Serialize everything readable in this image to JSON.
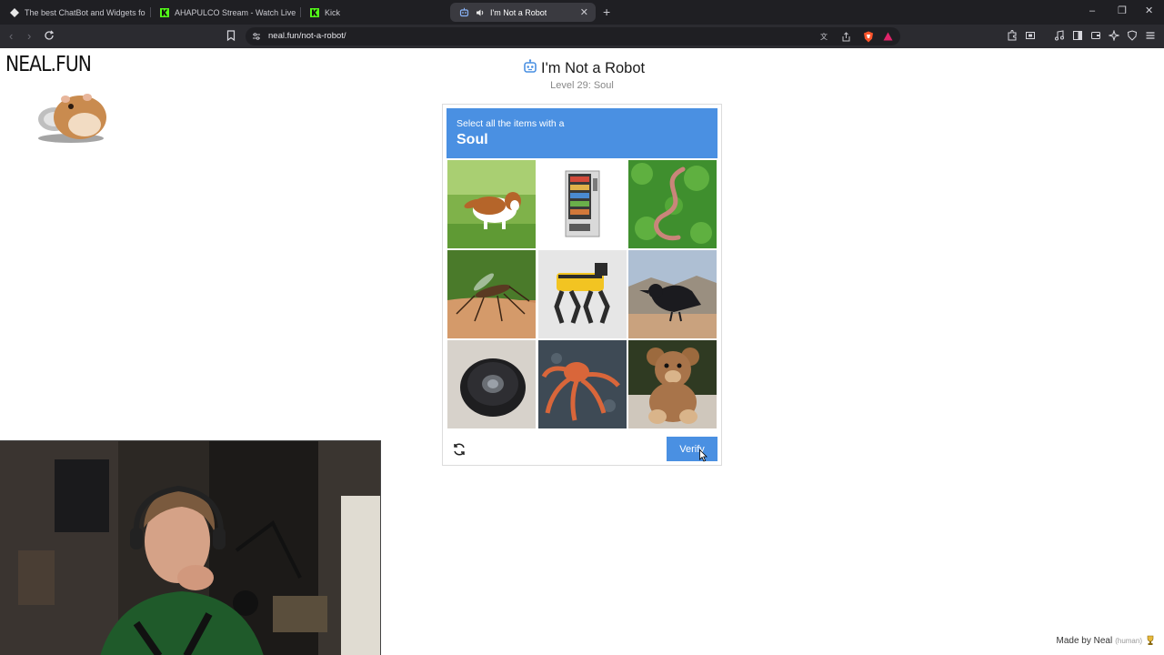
{
  "browser": {
    "tabs": [
      {
        "title": "The best ChatBot and Widgets for Ki",
        "icon": "diamond-icon",
        "active": false
      },
      {
        "title": "AHAPULCO Stream - Watch Live on K",
        "icon": "kick-icon",
        "active": false
      },
      {
        "title": "Kick",
        "icon": "kick-icon",
        "active": false
      },
      {
        "title": "I'm Not a Robot",
        "icon": "robot-icon",
        "active": true
      }
    ],
    "new_tab": "+",
    "url": "neal.fun/not-a-robot/",
    "window_controls": {
      "minimize": "–",
      "restore": "❐",
      "close": "✕"
    }
  },
  "site": {
    "logo": "NEAL.FUN",
    "title": "I'm Not a Robot",
    "level": "Level 29: Soul"
  },
  "captcha": {
    "instruction": "Select all the items with a",
    "target": "Soul",
    "images": [
      "dog",
      "vending-machine",
      "worm",
      "mosquito",
      "robot-dog",
      "crow",
      "robot-vacuum",
      "octopus",
      "teddy-bear"
    ],
    "verify_label": "Verify"
  },
  "footer": {
    "made_by": "Made by Neal",
    "human": "(human)"
  },
  "colors": {
    "accent": "#4a90e2",
    "tab_bar": "#1f1f23",
    "toolbar": "#2b2b30"
  }
}
